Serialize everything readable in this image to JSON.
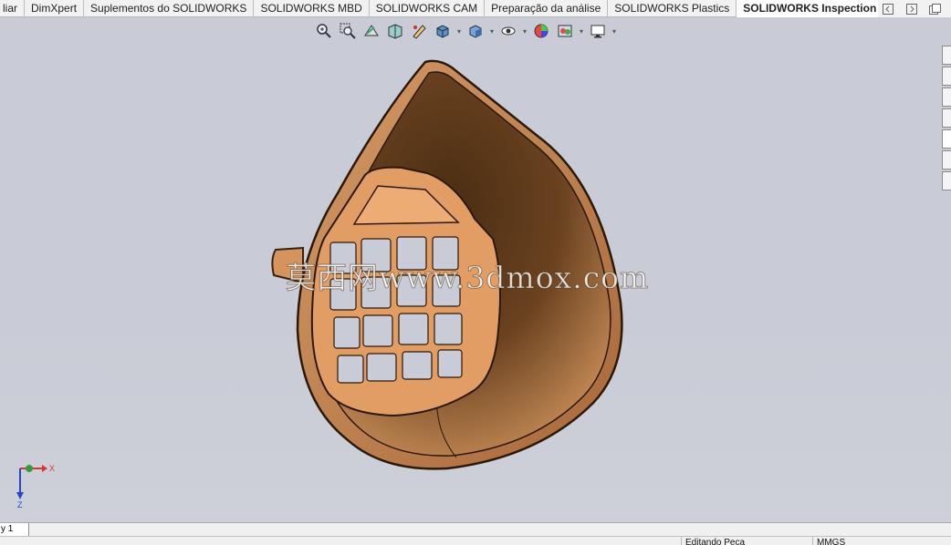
{
  "tabs": [
    {
      "label": "liar",
      "active": false
    },
    {
      "label": "DimXpert",
      "active": false
    },
    {
      "label": "Suplementos do SOLIDWORKS",
      "active": false
    },
    {
      "label": "SOLIDWORKS MBD",
      "active": false
    },
    {
      "label": "SOLIDWORKS CAM",
      "active": false
    },
    {
      "label": "Preparação da análise",
      "active": false
    },
    {
      "label": "SOLIDWORKS Plastics",
      "active": false
    },
    {
      "label": "SOLIDWORKS Inspection",
      "active": true
    }
  ],
  "tab_controls": [
    "dock-left-icon",
    "dock-right-icon",
    "maximize-icon"
  ],
  "hud_toolbar": [
    "zoom-to-fit-icon",
    "zoom-to-area-icon",
    "previous-view-icon",
    "section-view-icon",
    "dynamic-annotation-icon",
    "view-orientation-icon",
    "display-style-icon",
    "hide-show-icon",
    "edit-appearance-icon",
    "apply-scene-icon",
    "view-settings-icon"
  ],
  "watermark": "莫西网www.3dmox.com",
  "triad": {
    "x_label": "X",
    "z_label": "Z"
  },
  "sheet_tab": "y 1",
  "status": {
    "editing": "Editando Peça",
    "units": "MMGS"
  },
  "colors": {
    "viewport_bg": "#c9ccd6",
    "model_outer": "#c07a45",
    "model_inner": "#5a3818",
    "filter_frame": "#e7a06c",
    "triad_x": "#d33",
    "triad_z": "#2a44c8"
  }
}
